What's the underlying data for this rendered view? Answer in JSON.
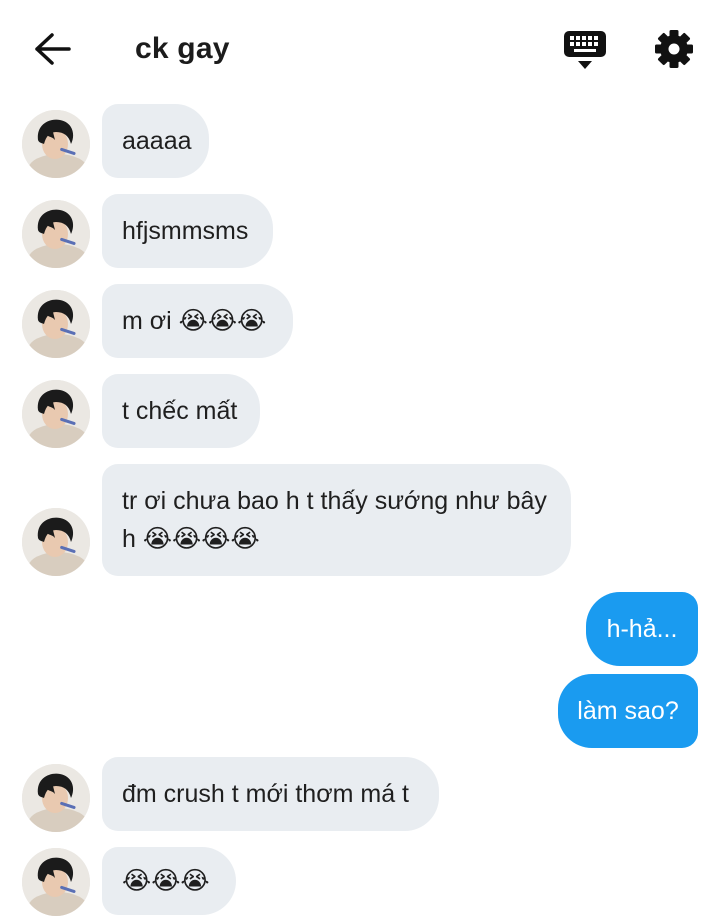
{
  "header": {
    "back_icon": "arrow-left-icon",
    "title": "ck gay",
    "keyboard_icon": "keyboard-icon",
    "settings_icon": "gear-icon"
  },
  "colors": {
    "incoming_bubble": "#e9edf1",
    "outgoing_bubble": "#1a9bf0",
    "text": "#1c1c1c"
  },
  "messages": [
    {
      "side": "in",
      "text": "aaaaa"
    },
    {
      "side": "in",
      "text": "hfjsmmsms"
    },
    {
      "side": "in",
      "text": "m ơi 😭😭😭"
    },
    {
      "side": "in",
      "text": "t chếc mất"
    },
    {
      "side": "in",
      "text": "tr ơi chưa bao h t thấy sướng như bây h 😭😭😭😭"
    },
    {
      "side": "out",
      "text": "h-hả..."
    },
    {
      "side": "out",
      "text": "làm sao?"
    },
    {
      "side": "in",
      "text": "đm crush t mới thơm má t"
    },
    {
      "side": "in",
      "text": "😭😭😭"
    }
  ]
}
